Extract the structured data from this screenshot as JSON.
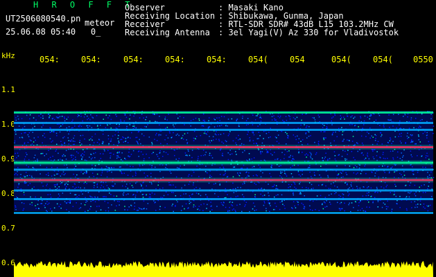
{
  "header": {
    "app_title": "H R O F F T",
    "filename": "UT2506080540.pn",
    "mode": "meteor",
    "datetime": "25.06.08 05:40",
    "datetime_suffix": "0_"
  },
  "station": {
    "labels": "Observer\nReceiving Location\nReceiver\nReceiving Antenna",
    "values": ": Masaki Kano\n: Shibukawa, Gunma, Japan\n: RTL-SDR SDR# 43dB L15 103.2MHz CW\n: 3el Yagi(V) Az 330 for Vladivostok"
  },
  "axis": {
    "unit": "kHz",
    "time_ticks": [
      "054:",
      "054:",
      "054:",
      "054:",
      "054:",
      "054(",
      "054",
      "054(",
      "054(",
      "0550"
    ],
    "freq_ticks": [
      "1.1",
      "1.0",
      "0.9",
      "0.8",
      "0.7",
      "0.6"
    ]
  },
  "colors": {
    "background": "#000000",
    "label": "#ffff00",
    "title": "#00ff66",
    "noise_low": "#0010ff",
    "signal": "#00ff99",
    "hot": "#ff3366",
    "amplitude": "#ffff00"
  },
  "spectrogram": {
    "bands": [
      {
        "freq_khz": 1.035,
        "strength": 0.55
      },
      {
        "freq_khz": 1.005,
        "strength": 0.45
      },
      {
        "freq_khz": 0.985,
        "strength": 0.4
      },
      {
        "freq_khz": 0.935,
        "strength": 1.0
      },
      {
        "freq_khz": 0.89,
        "strength": 0.7
      },
      {
        "freq_khz": 0.87,
        "strength": 0.4
      },
      {
        "freq_khz": 0.84,
        "strength": 0.95
      },
      {
        "freq_khz": 0.81,
        "strength": 0.5
      },
      {
        "freq_khz": 0.785,
        "strength": 0.35
      },
      {
        "freq_khz": 0.745,
        "strength": 0.45
      }
    ],
    "noise_range_khz": [
      0.75,
      1.04
    ]
  }
}
